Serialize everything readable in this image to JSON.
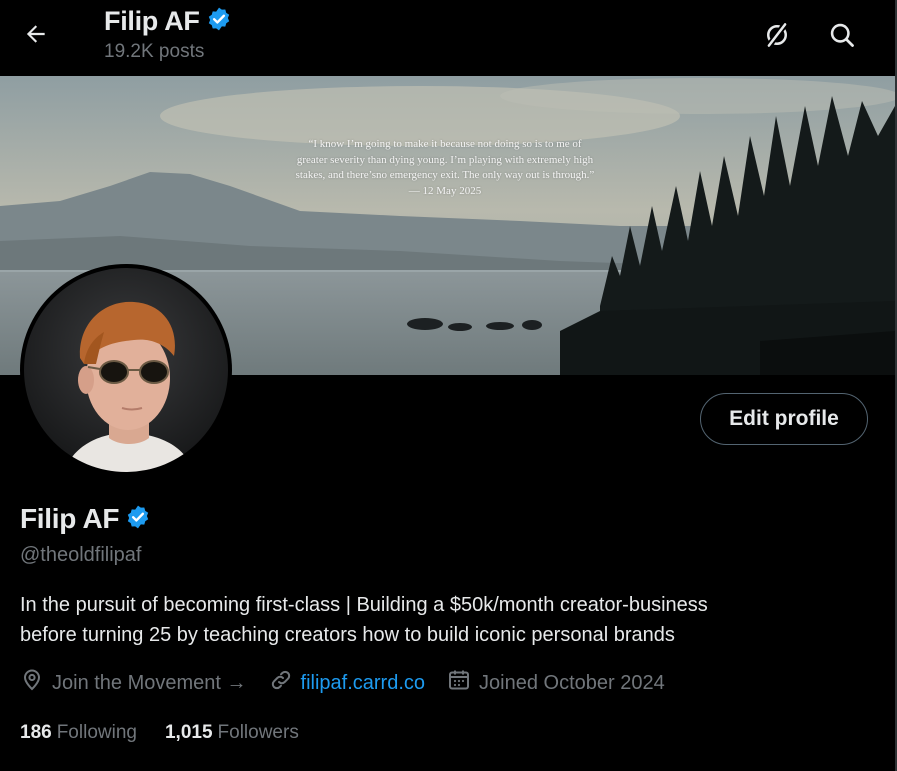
{
  "header": {
    "title": "Filip AF",
    "posts": "19.2K posts"
  },
  "banner": {
    "quote_line1": "“I know I’m going to make it because not doing so is to me of",
    "quote_line2": "greater severity than dying young. I’m playing with extremely high",
    "quote_line3": "stakes, and there’sno emergency exit. The only way out is through.”",
    "quote_date": "— 12 May 2025"
  },
  "profile": {
    "edit_label": "Edit profile",
    "name": "Filip AF",
    "handle": "@theoldfilipaf",
    "bio_line1": "In the pursuit of becoming first-class | Building a $50k/month creator-business",
    "bio_line2": "before turning 25 by teaching creators how to build iconic personal brands",
    "location": "Join the Movement →",
    "website": "filipaf.carrd.co",
    "joined": "Joined October 2024",
    "following_count": "186",
    "following_label": "Following",
    "followers_count": "1,015",
    "followers_label": "Followers"
  },
  "colors": {
    "background": "#000000",
    "text": "#e7e9ea",
    "muted": "#71767b",
    "accent": "#1d9bf0",
    "verified": "#1d9bf0"
  },
  "icons": [
    "back-arrow-icon",
    "verified-badge-icon",
    "disconnect-icon",
    "search-icon",
    "location-icon",
    "link-icon",
    "calendar-icon"
  ]
}
